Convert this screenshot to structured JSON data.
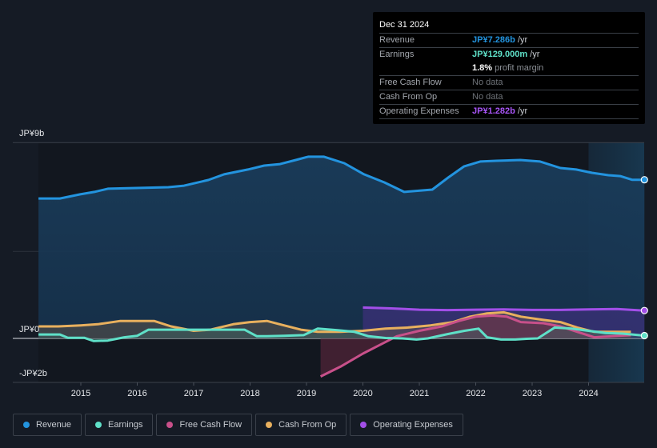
{
  "tooltip": {
    "date": "Dec 31 2024",
    "rows": [
      {
        "label": "Revenue",
        "value": "JP¥7.286b",
        "unit": " /yr",
        "color": "#2394df"
      },
      {
        "label": "Earnings",
        "value": "JP¥129.000m",
        "unit": " /yr",
        "color": "#5fe0c8"
      },
      {
        "label": "",
        "value": "1.8%",
        "unit": " profit margin",
        "color": "#ffffff"
      },
      {
        "label": "Free Cash Flow",
        "value": "No data",
        "unit": "",
        "color": "#6e7278"
      },
      {
        "label": "Cash From Op",
        "value": "No data",
        "unit": "",
        "color": "#6e7278"
      },
      {
        "label": "Operating Expenses",
        "value": "JP¥1.282b",
        "unit": " /yr",
        "color": "#a855f7"
      }
    ]
  },
  "legend": [
    {
      "label": "Revenue",
      "color": "#2394df"
    },
    {
      "label": "Earnings",
      "color": "#5fe0c8"
    },
    {
      "label": "Free Cash Flow",
      "color": "#c8508a"
    },
    {
      "label": "Cash From Op",
      "color": "#e8b05e"
    },
    {
      "label": "Operating Expenses",
      "color": "#a24fe8"
    }
  ],
  "chart_data": {
    "type": "area",
    "title": "",
    "xlabel": "",
    "ylabel": "",
    "x_ticks": [
      "2015",
      "2016",
      "2017",
      "2018",
      "2019",
      "2020",
      "2021",
      "2022",
      "2023",
      "2024"
    ],
    "y_ticks": [
      {
        "value": 9,
        "label": "JP¥9b"
      },
      {
        "value": 0,
        "label": "JP¥0"
      },
      {
        "value": -2,
        "label": "-JP¥2b"
      }
    ],
    "ylim": [
      -2,
      9
    ],
    "xlim": [
      2014.25,
      2024.99
    ],
    "units": "JP¥ billions",
    "forecast_shade_start": 2024.0,
    "series": [
      {
        "name": "Revenue",
        "color": "#2394df",
        "x": [
          2014.25,
          2014.63,
          2014.99,
          2015.24,
          2015.48,
          2015.98,
          2016.55,
          2016.83,
          2017.26,
          2017.54,
          2017.96,
          2018.25,
          2018.53,
          2018.81,
          2019.03,
          2019.31,
          2019.67,
          2020.02,
          2020.38,
          2020.73,
          2021.23,
          2021.51,
          2021.79,
          2022.08,
          2022.36,
          2022.79,
          2023.14,
          2023.5,
          2023.78,
          2024.06,
          2024.35,
          2024.56,
          2024.77,
          2024.99
        ],
        "values": [
          6.43,
          6.43,
          6.62,
          6.73,
          6.88,
          6.91,
          6.95,
          7.02,
          7.28,
          7.54,
          7.76,
          7.94,
          8.01,
          8.2,
          8.35,
          8.35,
          8.05,
          7.54,
          7.17,
          6.73,
          6.84,
          7.39,
          7.9,
          8.13,
          8.16,
          8.2,
          8.13,
          7.83,
          7.76,
          7.61,
          7.5,
          7.46,
          7.29,
          7.29
        ]
      },
      {
        "name": "Earnings",
        "color": "#5fe0c8",
        "x": [
          2014.25,
          2014.63,
          2014.77,
          2015.06,
          2015.23,
          2015.48,
          2015.77,
          2016.0,
          2016.2,
          2016.4,
          2016.75,
          2017.0,
          2017.3,
          2017.6,
          2017.9,
          2018.12,
          2018.3,
          2018.6,
          2018.95,
          2019.2,
          2019.55,
          2019.85,
          2020.1,
          2020.4,
          2020.7,
          2020.95,
          2021.15,
          2021.5,
          2021.8,
          2022.05,
          2022.2,
          2022.45,
          2022.7,
          2022.9,
          2023.1,
          2023.4,
          2023.7,
          2024.0,
          2024.3,
          2024.6,
          2024.99
        ],
        "values": [
          0.18,
          0.18,
          0.03,
          0.03,
          -0.12,
          -0.1,
          0.05,
          0.12,
          0.4,
          0.4,
          0.4,
          0.4,
          0.4,
          0.4,
          0.4,
          0.1,
          0.1,
          0.12,
          0.15,
          0.45,
          0.38,
          0.3,
          0.1,
          0.02,
          0.0,
          -0.05,
          0.0,
          0.2,
          0.35,
          0.45,
          0.05,
          -0.05,
          -0.05,
          -0.02,
          0.0,
          0.5,
          0.45,
          0.35,
          0.25,
          0.22,
          0.13
        ]
      },
      {
        "name": "Free Cash Flow",
        "color": "#c8508a",
        "x": [
          2019.25,
          2019.6,
          2020.0,
          2020.3,
          2020.6,
          2021.0,
          2021.4,
          2021.7,
          2022.0,
          2022.3,
          2022.55,
          2022.8,
          2023.2,
          2023.5,
          2023.8,
          2024.1,
          2024.4,
          2024.75
        ],
        "values": [
          -1.75,
          -1.3,
          -0.7,
          -0.3,
          0.1,
          0.35,
          0.55,
          0.8,
          1.0,
          1.05,
          1.0,
          0.75,
          0.7,
          0.55,
          0.3,
          0.05,
          0.1,
          0.15
        ]
      },
      {
        "name": "Cash From Op",
        "color": "#e8b05e",
        "x": [
          2014.25,
          2014.6,
          2015.0,
          2015.3,
          2015.7,
          2016.0,
          2016.3,
          2016.6,
          2017.0,
          2017.3,
          2017.7,
          2018.0,
          2018.3,
          2018.6,
          2018.9,
          2019.2,
          2019.6,
          2020.0,
          2020.4,
          2020.8,
          2021.2,
          2021.6,
          2021.9,
          2022.2,
          2022.5,
          2022.8,
          2023.2,
          2023.5,
          2023.8,
          2024.1,
          2024.4,
          2024.75
        ],
        "values": [
          0.55,
          0.55,
          0.6,
          0.65,
          0.8,
          0.8,
          0.8,
          0.55,
          0.35,
          0.4,
          0.65,
          0.75,
          0.8,
          0.6,
          0.4,
          0.3,
          0.3,
          0.35,
          0.45,
          0.5,
          0.6,
          0.75,
          1.0,
          1.15,
          1.2,
          1.0,
          0.85,
          0.75,
          0.5,
          0.3,
          0.3,
          0.3
        ]
      },
      {
        "name": "Operating Expenses",
        "color": "#a24fe8",
        "x": [
          2020.0,
          2020.5,
          2021.0,
          2021.5,
          2022.0,
          2022.5,
          2023.0,
          2023.5,
          2024.0,
          2024.5,
          2024.99
        ],
        "values": [
          1.42,
          1.38,
          1.32,
          1.3,
          1.32,
          1.33,
          1.31,
          1.31,
          1.33,
          1.35,
          1.28
        ]
      }
    ]
  }
}
